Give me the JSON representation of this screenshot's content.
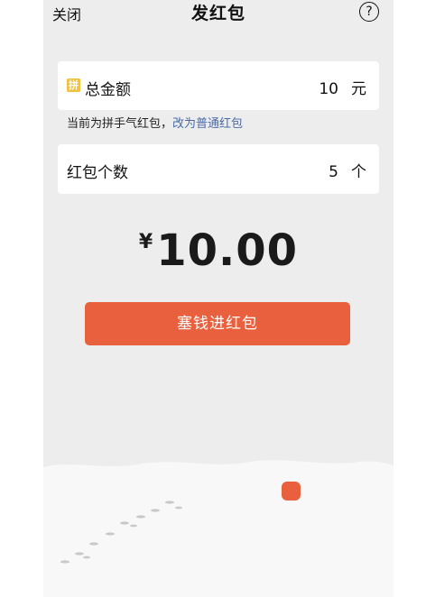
{
  "nav": {
    "close_label": "关闭",
    "title": "发红包",
    "help_glyph": "?"
  },
  "total_card": {
    "badge": "拼",
    "label": "总金额",
    "value": "10",
    "unit": "元"
  },
  "hint": {
    "text": "当前为拼手气红包，",
    "link": "改为普通红包"
  },
  "count_card": {
    "label": "红包个数",
    "value": "5",
    "unit": "个"
  },
  "amount": {
    "currency": "¥",
    "value": "10.00"
  },
  "send_button": {
    "label": "塞钱进红包"
  },
  "colors": {
    "accent": "#e8603e",
    "badge": "#f0c23e",
    "link": "#4a6aa8",
    "background": "#ededed"
  },
  "icons": {
    "help": "question-circle-icon",
    "badge": "pin-badge-icon"
  }
}
